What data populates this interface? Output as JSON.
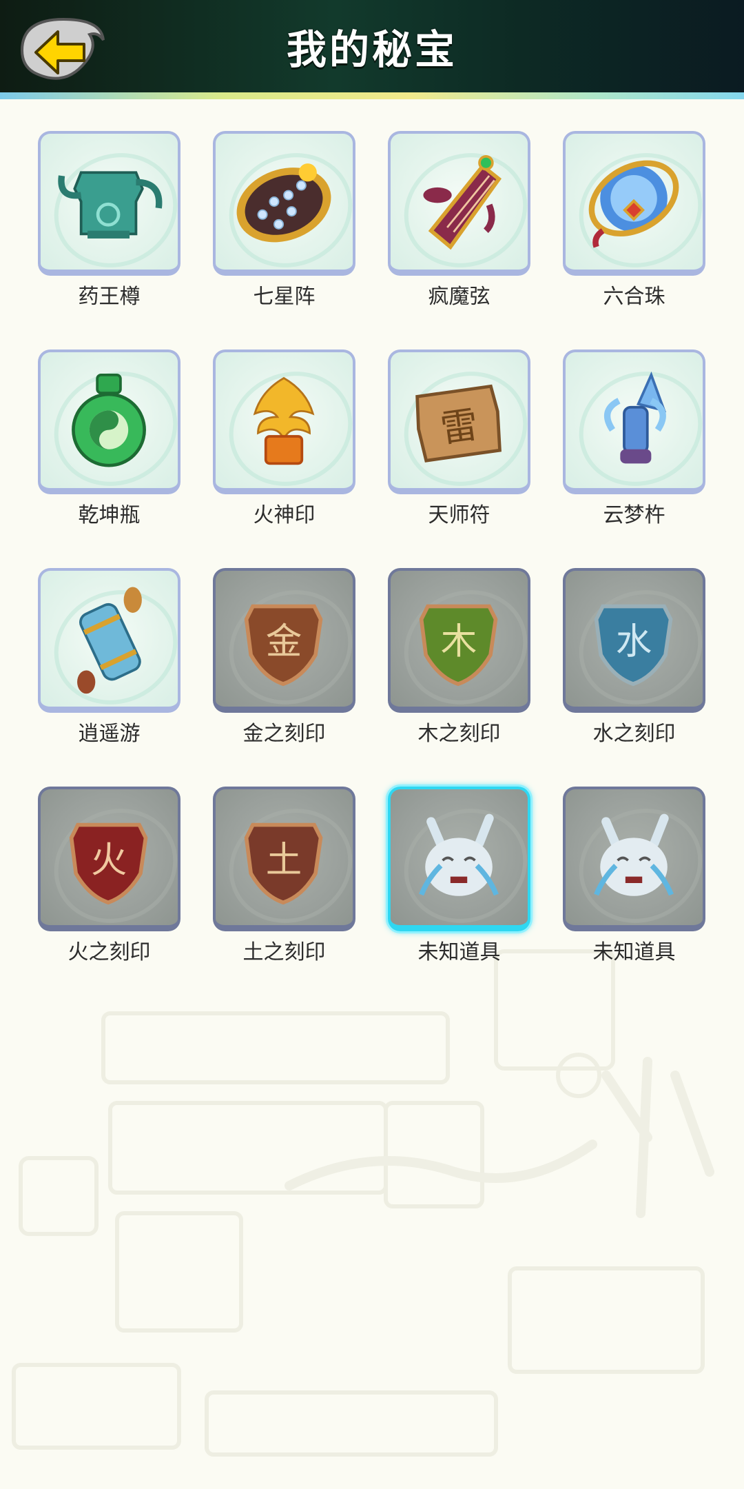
{
  "header": {
    "title": "我的秘宝"
  },
  "items": [
    {
      "label": "药王樽",
      "icon": "jade-vessel-icon",
      "locked": false
    },
    {
      "label": "七星阵",
      "icon": "seven-star-disc-icon",
      "locked": false
    },
    {
      "label": "疯魔弦",
      "icon": "demon-zither-icon",
      "locked": false
    },
    {
      "label": "六合珠",
      "icon": "orb-ring-icon",
      "locked": false
    },
    {
      "label": "乾坤瓶",
      "icon": "yin-yang-bottle-icon",
      "locked": false
    },
    {
      "label": "火神印",
      "icon": "phoenix-seal-icon",
      "locked": false
    },
    {
      "label": "天师符",
      "icon": "talisman-tablet-icon",
      "locked": false
    },
    {
      "label": "云梦杵",
      "icon": "cloud-pestle-icon",
      "locked": false
    },
    {
      "label": "逍遥游",
      "icon": "scroll-icon",
      "locked": false
    },
    {
      "label": "金之刻印",
      "icon": "metal-seal-icon",
      "locked": true
    },
    {
      "label": "木之刻印",
      "icon": "wood-seal-icon",
      "locked": true
    },
    {
      "label": "水之刻印",
      "icon": "water-seal-icon",
      "locked": true
    },
    {
      "label": "火之刻印",
      "icon": "fire-seal-icon",
      "locked": true
    },
    {
      "label": "土之刻印",
      "icon": "earth-seal-icon",
      "locked": true
    },
    {
      "label": "未知道具",
      "icon": "crying-spirit-icon",
      "locked": true,
      "selected": true
    },
    {
      "label": "未知道具",
      "icon": "crying-spirit-icon",
      "locked": true
    }
  ],
  "colors": {
    "header_bg": "#0e1c13",
    "tile_border": "#a9b6e0",
    "tile_locked_border": "#6f789a",
    "selected_border": "#2fd7f1",
    "label_text": "#2c2c2c"
  }
}
